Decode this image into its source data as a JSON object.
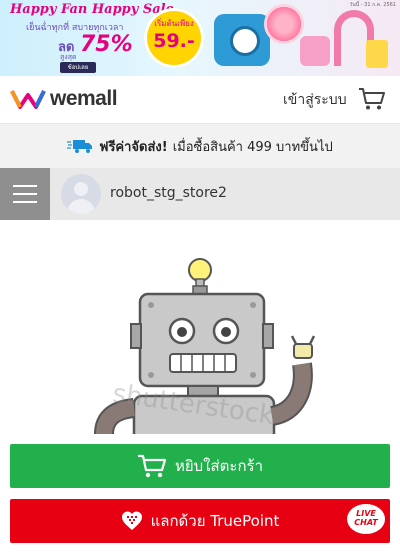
{
  "banner": {
    "headline": "Happy Fan Happy Sale",
    "subline": "เย็นฉ่ำทุกที่ สบายทุกเวลา",
    "discount_prefix": "ลด",
    "discount_upto": "สูงสุด",
    "discount_value": "75%",
    "shop_now": "ช้อปเลย",
    "price_from": "เริ่มต้นเพียง",
    "price_value": "59.-",
    "fine_print": "วันนี้ - 31 ก.ค. 2561"
  },
  "header": {
    "logo_text": "wemall",
    "login_label": "เข้าสู่ระบบ",
    "cart_icon": "cart-icon"
  },
  "shipping": {
    "icon": "truck-icon",
    "bold_text": "ฟรีค่าจัดส่ง!",
    "text": "เมื่อซื้อสินค้า 499 บาทขึ้นไป"
  },
  "store": {
    "menu_icon": "hamburger-menu-icon",
    "name": "robot_stg_store2"
  },
  "product_image": {
    "watermark": "shutterstock"
  },
  "actions": {
    "add_to_cart_label": "หยิบใส่ตะกร้า",
    "truepoint_label": "แลกด้วย TruePoint",
    "live_chat_line1": "LIVE",
    "live_chat_line2": "CHAT"
  },
  "colors": {
    "cart_green": "#21b04b",
    "truepoint_red": "#e60012",
    "accent_pink": "#e4007f"
  }
}
